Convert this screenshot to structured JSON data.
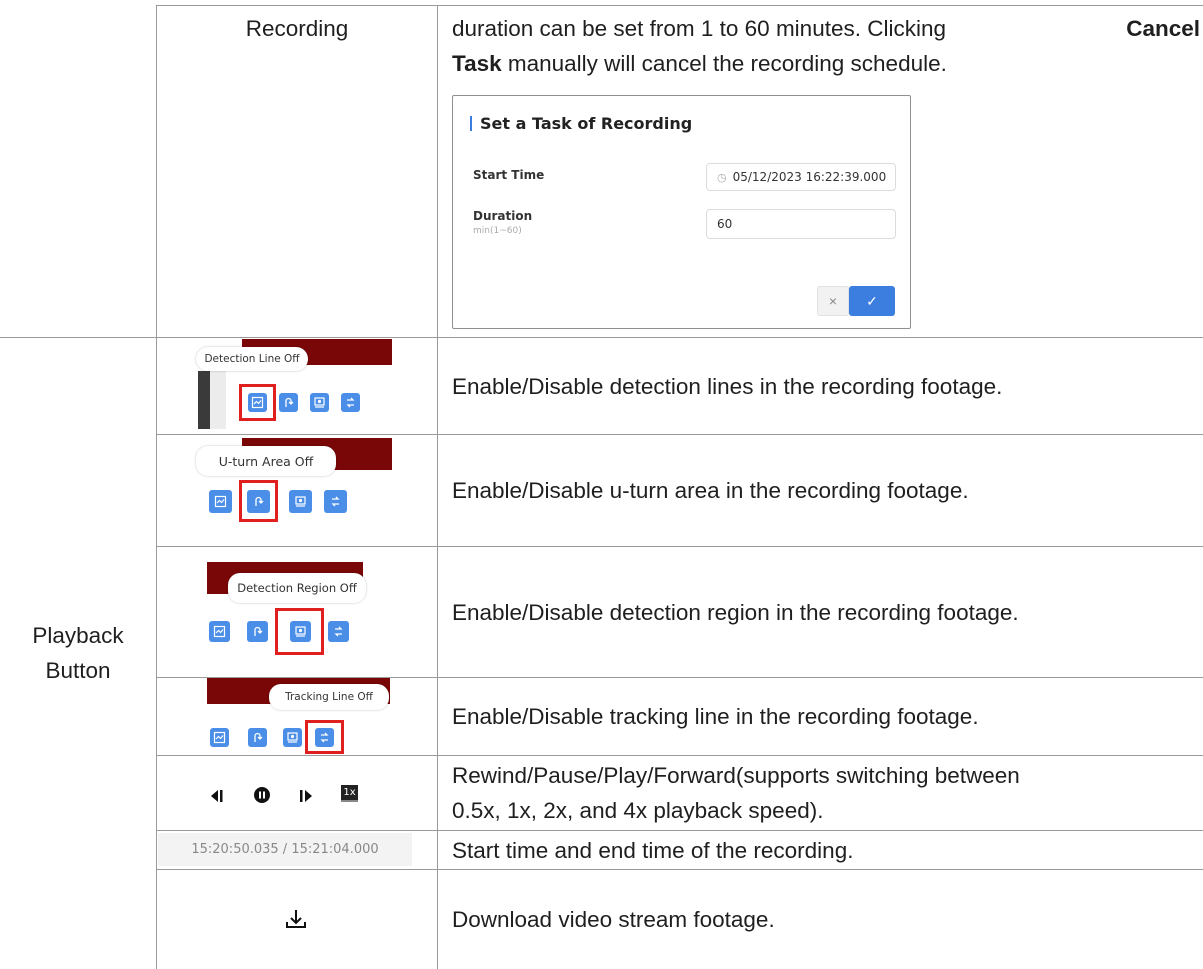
{
  "rows": {
    "recording": {
      "label": "Recording",
      "desc_part1": "duration can be set from 1 to 60 minutes. Clicking ",
      "desc_bold1": "Cancel",
      "desc_bold2": "Task",
      "desc_part2": " manually will cancel the recording schedule."
    },
    "group_label_line1": "Playback",
    "group_label_line2": "Button",
    "detection_line": {
      "tooltip": "Detection Line Off",
      "desc": "Enable/Disable detection lines in the recording footage."
    },
    "uturn_area": {
      "tooltip": "U-turn Area Off",
      "desc": "Enable/Disable u-turn area in the recording footage."
    },
    "detection_region": {
      "tooltip": "Detection Region Off",
      "desc": "Enable/Disable detection region in the recording footage."
    },
    "tracking_line": {
      "tooltip": "Tracking Line Off",
      "desc": "Enable/Disable tracking line in the recording footage."
    },
    "playback_controls": {
      "speed_label": "1x",
      "desc_line1": "Rewind/Pause/Play/Forward(supports switching between",
      "desc_line2": "0.5x, 1x, 2x, and 4x playback speed)."
    },
    "time_range": {
      "value": "15:20:50.035 / 15:21:04.000",
      "desc": "Start time and end time of the recording."
    },
    "download": {
      "desc": "Download video stream footage."
    }
  },
  "dialog": {
    "title": "Set a Task of Recording",
    "start_time_label": "Start Time",
    "start_time_value": "05/12/2023 16:22:39.000",
    "duration_label": "Duration",
    "duration_hint": "min(1~60)",
    "duration_value": "60",
    "cancel_glyph": "×",
    "confirm_glyph": "✓"
  },
  "colors": {
    "accent": "#3b7ee0",
    "icon_button": "#4a8ee8",
    "highlight": "#e0201f",
    "dark_red": "#7a0707"
  }
}
